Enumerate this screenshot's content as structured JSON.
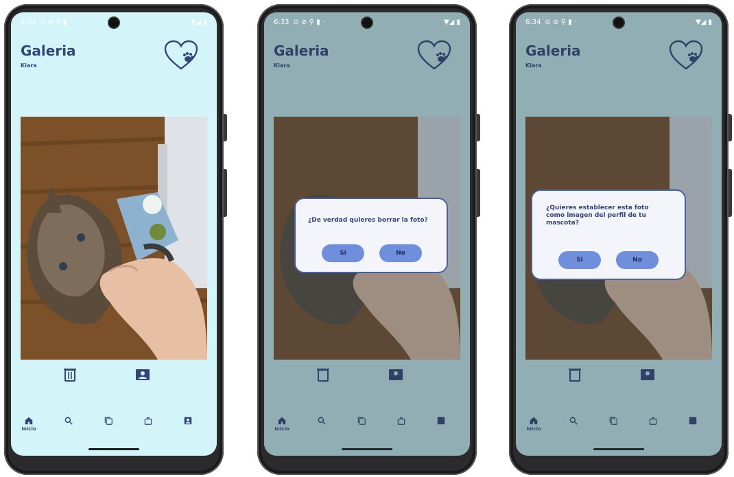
{
  "colors": {
    "accent": "#33457a",
    "screen_bg": "#d3f4f8",
    "dialog_button": "#6f8fdc",
    "dialog_border": "#4a5ea3"
  },
  "screens": [
    {
      "status_time": "6:33",
      "title": "Galeria",
      "pet_name": "Kiara",
      "photo_alt": "Cat biting hand",
      "actions": {
        "delete_icon": "trash-icon",
        "set_profile_icon": "profile-photo-icon"
      },
      "nav": {
        "items": [
          {
            "label": "Inicio",
            "icon": "home-icon"
          },
          {
            "label": "",
            "icon": "search-icon"
          },
          {
            "label": "",
            "icon": "gallery-icon"
          },
          {
            "label": "",
            "icon": "shopping-bag-icon"
          },
          {
            "label": "",
            "icon": "profile-icon"
          }
        ]
      }
    },
    {
      "status_time": "6:33",
      "title": "Galeria",
      "pet_name": "Kiara",
      "dialog": {
        "message": "¿De verdad quieres borrar la foto?",
        "yes": "Si",
        "no": "No"
      },
      "nav": {
        "home_label": "Inicio"
      }
    },
    {
      "status_time": "6:34",
      "title": "Galeria",
      "pet_name": "Kiara",
      "dialog": {
        "message": "¿Quieres establecer esta foto como imagen del perfil de tu mascota?",
        "yes": "Si",
        "no": "No"
      },
      "nav": {
        "home_label": "Inicio"
      }
    }
  ]
}
